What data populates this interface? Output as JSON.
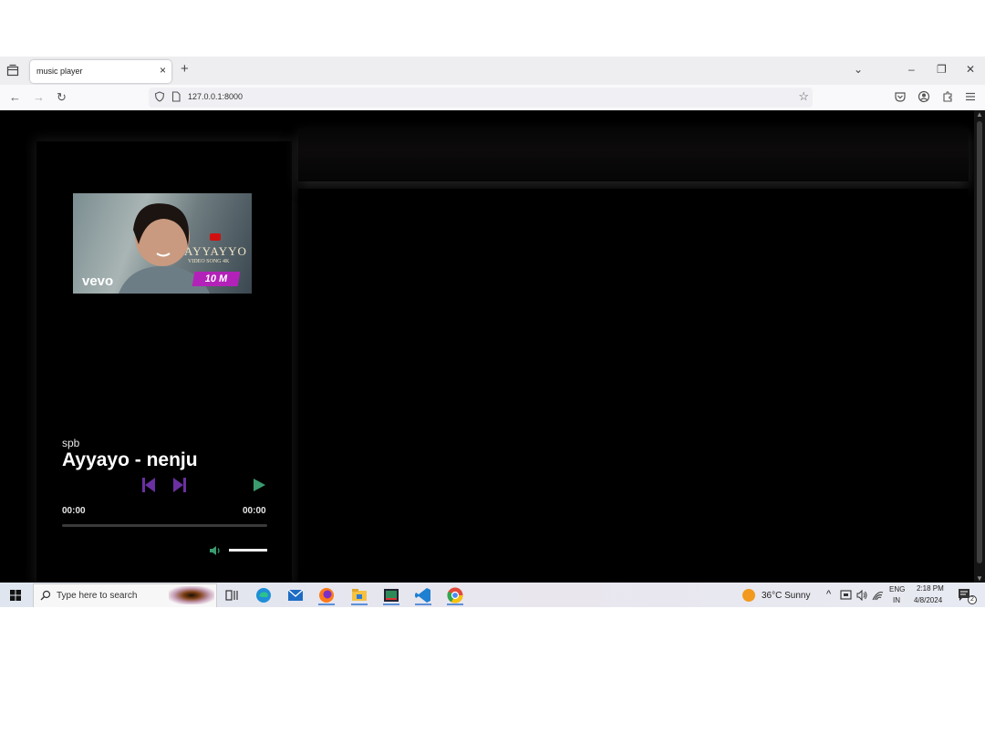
{
  "browser": {
    "tab_title": "music player",
    "tab_close": "×",
    "new_tab": "+",
    "url": "127.0.0.1:8000",
    "window_controls": {
      "list": "⌄",
      "minimize": "–",
      "restore": "❐",
      "close": "✕"
    },
    "nav": {
      "back": "←",
      "forward": "→",
      "reload": "↻"
    },
    "star": "☆"
  },
  "player": {
    "album_art": {
      "caption_title": "AYYAYYO",
      "caption_sub": "VIDEO SONG 4K",
      "badge": "10 M",
      "logo": "vevo"
    },
    "artist": "spb",
    "song_title": "Ayyayo - nenju",
    "current_time": "00:00",
    "duration": "00:00",
    "progress_fraction": 0,
    "volume_fraction": 1,
    "colors": {
      "skip": "#6a2fa0",
      "play": "#3a9b6e",
      "volume": "#3a9b6e"
    }
  },
  "taskbar": {
    "search_placeholder": "Type here to search",
    "apps": [
      "task-view-icon",
      "edge-icon",
      "mail-icon",
      "firefox-icon",
      "file-explorer-icon",
      "media-icon",
      "vscode-icon",
      "chrome-icon"
    ],
    "weather": "36°C  Sunny",
    "lang_top": "ENG",
    "lang_bottom": "IN",
    "time": "2:18 PM",
    "date": "4/8/2024",
    "notif_count": "2"
  }
}
